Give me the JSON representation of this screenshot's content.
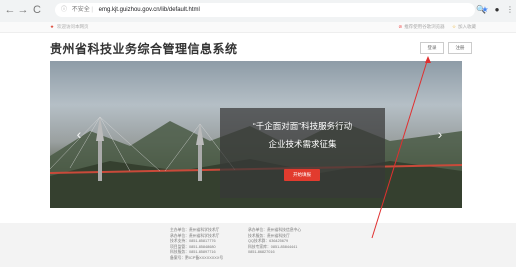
{
  "browser": {
    "back": "←",
    "forward": "→",
    "reload": "C",
    "info": "ⓘ",
    "insecure": "不安全",
    "url": "emg.kjt.guizhou.gov.cn/lib/default.html"
  },
  "topstrip": {
    "left_text": "欢迎访问本网页",
    "right_warn_text": "推荐使用谷歌浏览器",
    "right_fav_text": "加入收藏"
  },
  "header": {
    "title": "贵州省科技业务综合管理信息系统",
    "login_label": "登录",
    "register_label": "注册"
  },
  "banner": {
    "line1": "“千企面对面”科技服务行动",
    "line2": "企业技术需求征集",
    "cta_label": "开始填报",
    "prev": "‹",
    "next": "›",
    "slide_count": 4,
    "active_slide": 0
  },
  "footer": {
    "col1": [
      "主办单位：贵州省科学技术厅",
      "承办单位：贵州省科学技术厅",
      "技术支持：0851-85817776",
      "项目监管：0851-85848680",
      "科技服务：0851-85897716",
      "备案号：黔ICP备XXXXXXXX号"
    ],
    "col2": [
      "承办单位：贵州省科技信息中心",
      "技术服务：贵州省科技厅",
      "QQ技术群：636425679",
      "科技专家库：0851-85844441",
      "0851-86827016"
    ]
  },
  "colors": {
    "accent_red": "#e23b2e",
    "annotation_red": "#e03030"
  }
}
